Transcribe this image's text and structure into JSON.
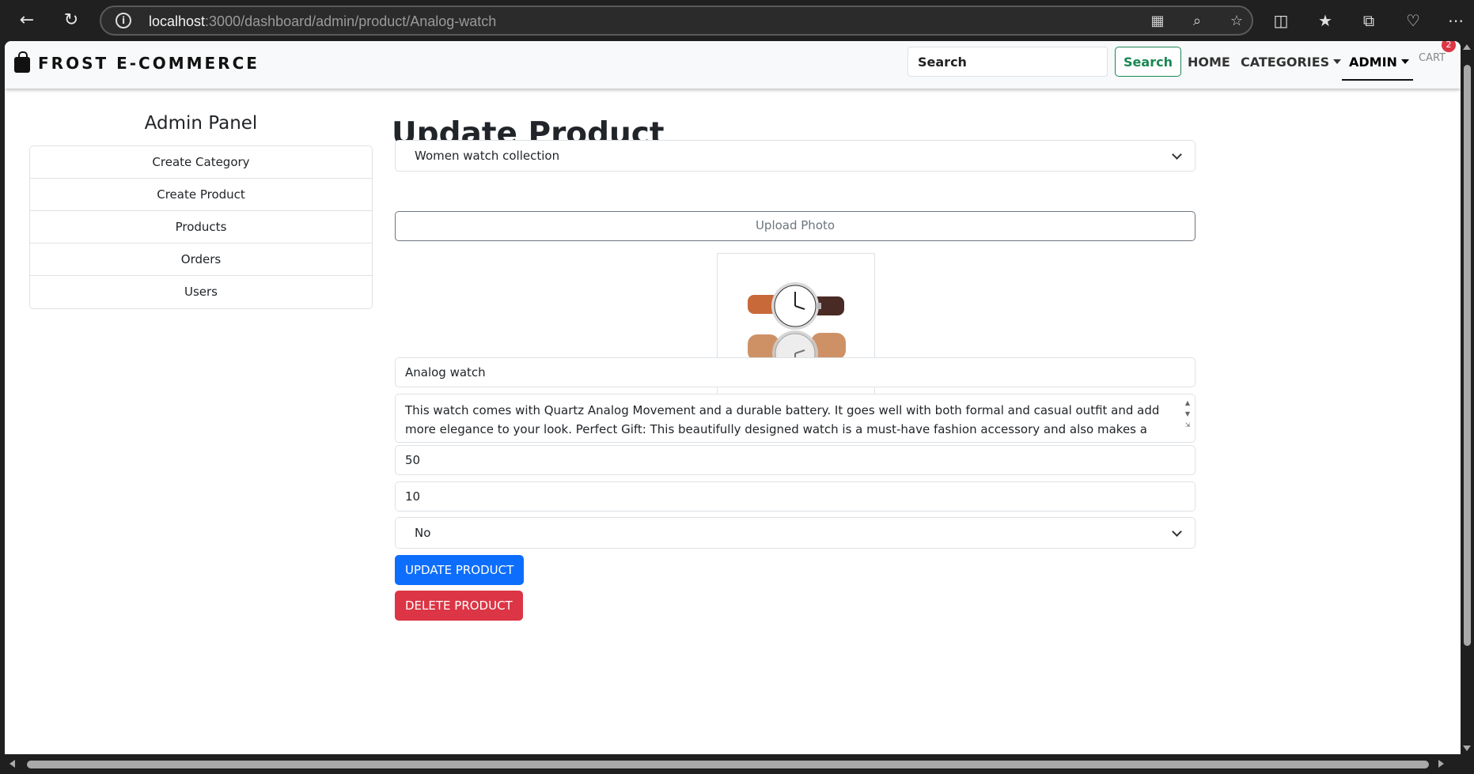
{
  "browser": {
    "url_host": "localhost",
    "url_path": ":3000/dashboard/admin/product/Analog-watch"
  },
  "navbar": {
    "brand": "FROST E-COMMERCE",
    "search_placeholder": "Search",
    "search_button": "Search",
    "links": [
      "HOME",
      "CATEGORIES",
      "ADMIN"
    ],
    "cart_label": "CART",
    "cart_count": "2"
  },
  "sidebar": {
    "title": "Admin Panel",
    "items": [
      {
        "label": "Create Category"
      },
      {
        "label": "Create Product"
      },
      {
        "label": "Products"
      },
      {
        "label": "Orders"
      },
      {
        "label": "Users"
      }
    ]
  },
  "form": {
    "title": "Update Product",
    "category": "Women watch collection",
    "upload_label": "Upload Photo",
    "name": "Analog watch",
    "description": "This watch comes with Quartz Analog Movement and a durable battery. It goes well with both formal and casual outfit and add more elegance to your look. Perfect Gift: This beautifully designed watch is a must-have fashion accessory and also makes a perfect gift for",
    "price": "50",
    "quantity": "10",
    "shipping": "No",
    "update_button": "UPDATE PRODUCT",
    "delete_button": "DELETE PRODUCT"
  },
  "icons": {
    "back": "arrow-left-icon",
    "refresh": "refresh-icon",
    "info": "info-icon",
    "bag": "shopping-bag-icon",
    "chevron": "chevron-down-icon"
  },
  "colors": {
    "primary": "#0d6efd",
    "danger": "#dc3545",
    "success": "#198754"
  }
}
